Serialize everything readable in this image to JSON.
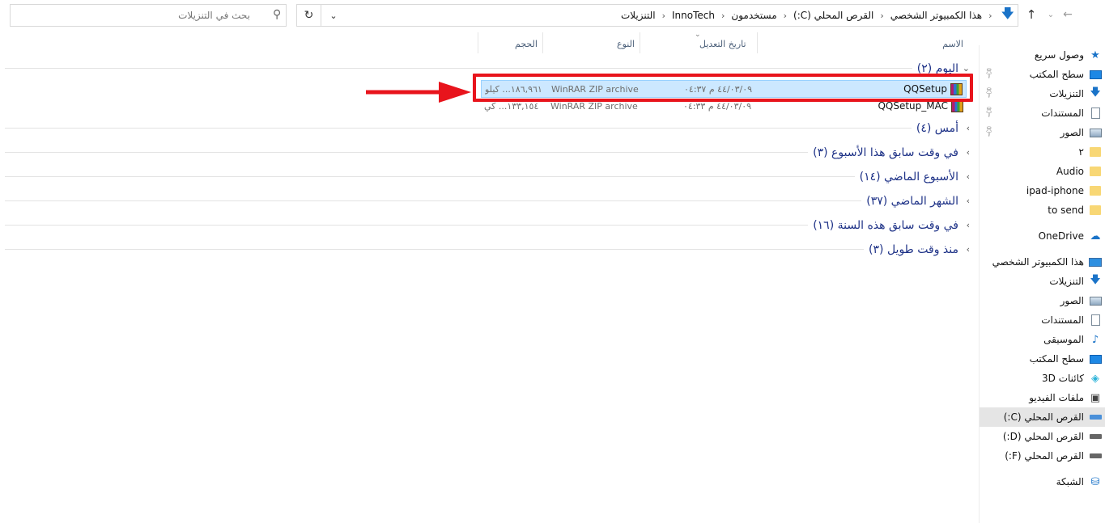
{
  "nav": {
    "back": "←",
    "forward": "→",
    "history": "⌄",
    "up": "↑",
    "refresh": "↻"
  },
  "breadcrumbs": [
    "هذا الكمبيوتر الشخصي",
    "القرص المحلي (C:)",
    "مستخدمون",
    "InnoTech",
    "التنزيلات"
  ],
  "search": {
    "placeholder": "بحث في التنزيلات"
  },
  "sidebar": {
    "quick_access": "وصول سريع",
    "items": [
      {
        "label": "سطح المكتب",
        "pinned": true
      },
      {
        "label": "التنزيلات",
        "pinned": true
      },
      {
        "label": "المستندات",
        "pinned": true
      },
      {
        "label": "الصور",
        "pinned": true
      },
      {
        "label": "٢"
      },
      {
        "label": "Audio"
      },
      {
        "label": "ipad-iphone"
      },
      {
        "label": "to send"
      }
    ],
    "onedrive": "OneDrive",
    "this_pc": "هذا الكمبيوتر الشخصي",
    "pc_items": [
      "التنزيلات",
      "الصور",
      "المستندات",
      "الموسيقى",
      "سطح المكتب",
      "كائنات 3D",
      "ملفات الفيديو"
    ],
    "drives": [
      "القرص المحلي (C:)",
      "القرص المحلي (D:)",
      "القرص المحلي (F:)"
    ],
    "network": "الشبكة"
  },
  "columns": {
    "name": "الاسم",
    "date": "تاريخ التعديل",
    "type": "النوع",
    "size": "الحجم"
  },
  "groups": [
    {
      "label": "اليوم (٢)",
      "expanded": true
    },
    {
      "label": "أمس (٤)"
    },
    {
      "label": "في وقت سابق هذا الأسبوع (٣)"
    },
    {
      "label": "الأسبوع الماضي (١٤)"
    },
    {
      "label": "الشهر الماضي (٣٧)"
    },
    {
      "label": "في وقت سابق هذه السنة (١٦)"
    },
    {
      "label": "منذ وقت طويل (٣)"
    }
  ],
  "files": [
    {
      "name": "QQSetup",
      "date": "٤٤/٠٣/٠٩ م ٠٤:٣٧",
      "type": "WinRAR ZIP archive",
      "size": "١٨٦,٩٦١... كيلو",
      "selected": true
    },
    {
      "name": "QQSetup_MAC",
      "date": "٤٤/٠٣/٠٩ م ٠٤:٣٣",
      "type": "WinRAR ZIP archive",
      "size": "١٣٣,١٥٤... كي"
    }
  ],
  "colors": {
    "highlight": "#e8141c",
    "selected_row": "#cce8ff",
    "group_text": "#1e3287"
  }
}
